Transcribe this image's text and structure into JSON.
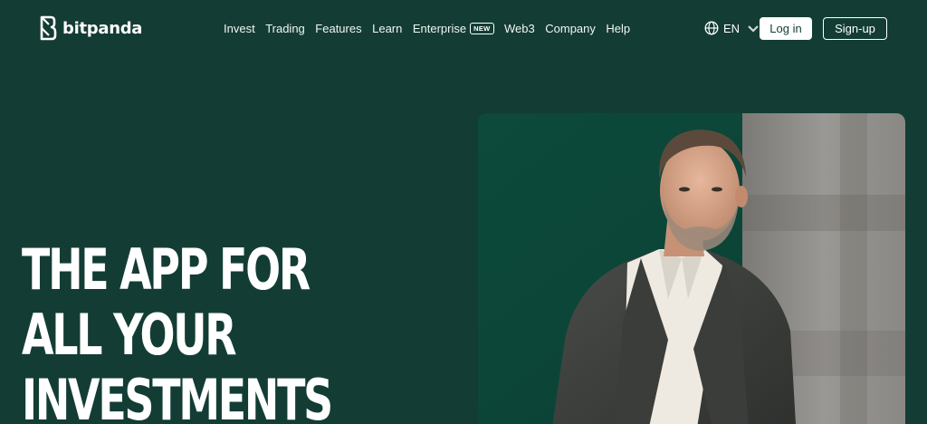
{
  "brand": {
    "name": "bitpanda",
    "logo_icon": "bitpanda-b-logo"
  },
  "nav": {
    "items": [
      {
        "label": "Invest"
      },
      {
        "label": "Trading"
      },
      {
        "label": "Features"
      },
      {
        "label": "Learn"
      },
      {
        "label": "Enterprise",
        "badge": "NEW"
      },
      {
        "label": "Web3"
      },
      {
        "label": "Company"
      },
      {
        "label": "Help"
      }
    ]
  },
  "language": {
    "label": "EN",
    "icon": "globe-icon"
  },
  "auth": {
    "login_label": "Log in",
    "signup_label": "Sign-up"
  },
  "hero": {
    "title_lines": [
      "THE APP FOR",
      "ALL YOUR",
      "INVESTMENTS"
    ],
    "image_alt": "Man in grey blazer and white shirt against green background"
  },
  "colors": {
    "background": "#133d34",
    "text": "#ffffff",
    "button_text": "#133d34"
  }
}
